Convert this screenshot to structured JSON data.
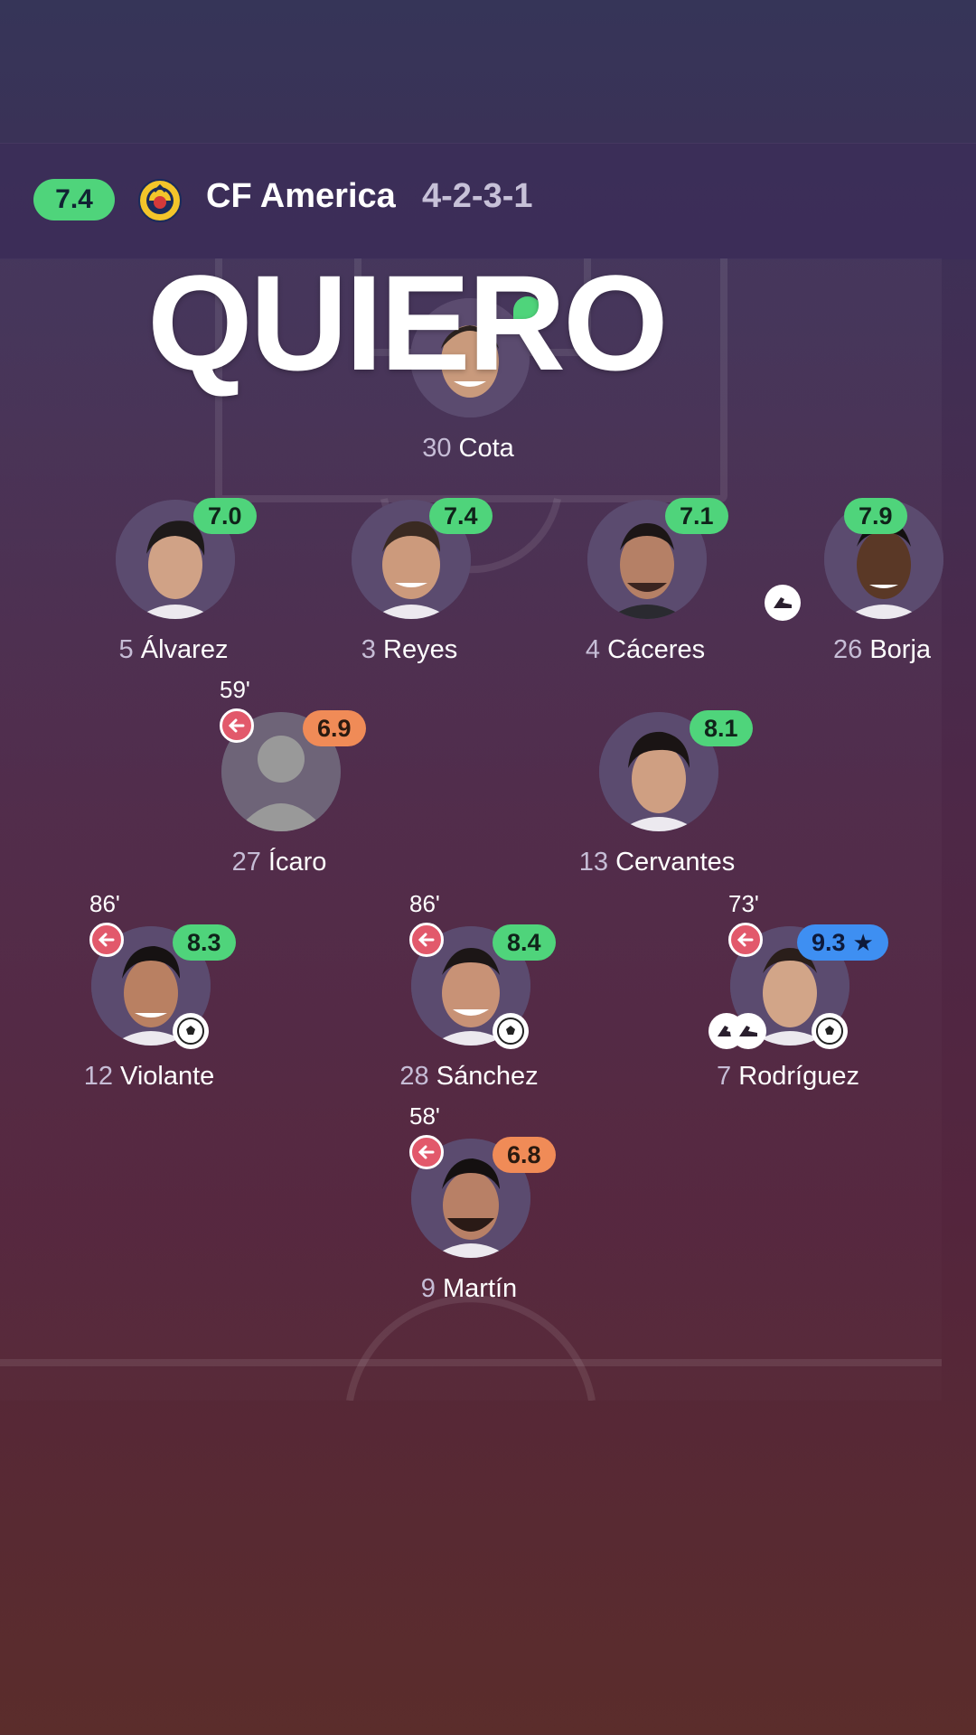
{
  "header": {
    "team_rating": "7.4",
    "team_name": "CF America",
    "formation": "4-2-3-1"
  },
  "overlay_text": "QUIERO",
  "colors": {
    "green_rating": "#4fd47b",
    "orange_rating": "#f08b57",
    "blue_rating": "#3e8ff2",
    "sub_icon": "#e2596b"
  },
  "players": [
    {
      "number": "30",
      "name": "Cota",
      "rating": "",
      "rating_color": "green"
    },
    {
      "number": "5",
      "name": "Álvarez",
      "rating": "7.0",
      "rating_color": "green"
    },
    {
      "number": "3",
      "name": "Reyes",
      "rating": "7.4",
      "rating_color": "green"
    },
    {
      "number": "4",
      "name": "Cáceres",
      "rating": "7.1",
      "rating_color": "green"
    },
    {
      "number": "26",
      "name": "Borja",
      "rating": "7.9",
      "rating_color": "green",
      "icons": [
        "boot-icon"
      ]
    },
    {
      "number": "27",
      "name": "Ícaro",
      "rating": "6.9",
      "rating_color": "orange",
      "sub_minute": "59'"
    },
    {
      "number": "13",
      "name": "Cervantes",
      "rating": "8.1",
      "rating_color": "green"
    },
    {
      "number": "12",
      "name": "Violante",
      "rating": "8.3",
      "rating_color": "green",
      "sub_minute": "86'",
      "icons": [
        "ball-icon"
      ]
    },
    {
      "number": "28",
      "name": "Sánchez",
      "rating": "8.4",
      "rating_color": "green",
      "sub_minute": "86'",
      "icons": [
        "ball-icon"
      ]
    },
    {
      "number": "7",
      "name": "Rodríguez",
      "rating": "9.3",
      "rating_color": "blue",
      "star": true,
      "sub_minute": "73'",
      "icons": [
        "boot-icon",
        "boot-icon",
        "ball-icon"
      ]
    },
    {
      "number": "9",
      "name": "Martín",
      "rating": "6.8",
      "rating_color": "orange",
      "sub_minute": "58'"
    }
  ]
}
